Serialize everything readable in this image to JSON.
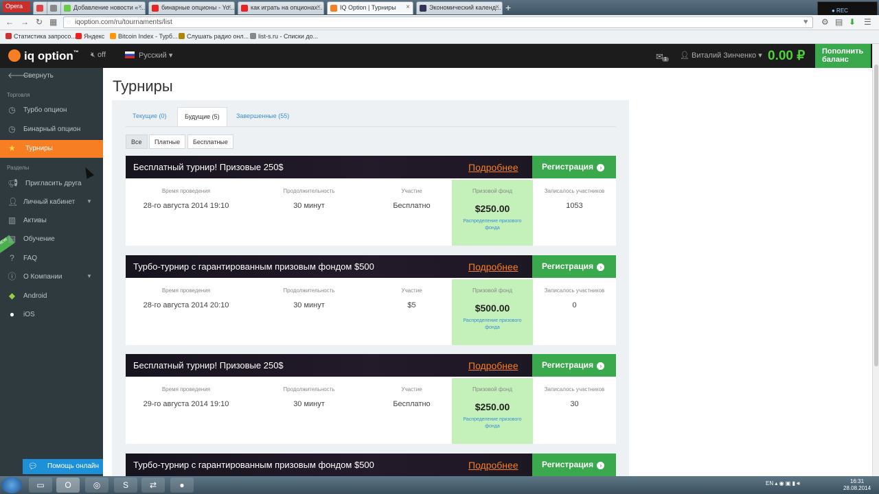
{
  "browser": {
    "opera_label": "Opera",
    "tabs": [
      {
        "label": "Добавление новости « ..."
      },
      {
        "label": "бинарные опционы - Yo..."
      },
      {
        "label": "как играть на опционах..."
      },
      {
        "label": "IQ Option | Турниры"
      },
      {
        "label": "Экономический календ..."
      }
    ],
    "url": "iqoption.com/ru/tournaments/list",
    "bookmarks": [
      {
        "label": "Статистика запросо..."
      },
      {
        "label": "Яндекс"
      },
      {
        "label": "Bitcoin Index - Турб..."
      },
      {
        "label": "Слушать радио онл..."
      },
      {
        "label": "list-s.ru - Списки до..."
      }
    ],
    "colors": {
      "accent": "#f77e23",
      "green": "#3aa84c",
      "balance": "#4cd137"
    }
  },
  "header": {
    "logo": "iq option",
    "logo_tm": "™",
    "sound": "off",
    "language": "Русский",
    "mail_count": "1",
    "user_name": "Виталий Зинченко",
    "balance": "0.00 ₽",
    "topup_line1": "Пополнить",
    "topup_line2": "баланс"
  },
  "sidebar": {
    "collapse": "Свернуть",
    "section_trading": "Торговля",
    "section_sections": "Разделы",
    "items": [
      {
        "label": "Турбо опцион",
        "icon": "clock-icon"
      },
      {
        "label": "Бинарный опцион",
        "icon": "clock-icon"
      },
      {
        "label": "Турниры",
        "icon": "star-icon"
      },
      {
        "label": "Пригласить друга",
        "icon": "megaphone-icon"
      },
      {
        "label": "Личный кабинет",
        "icon": "user-icon"
      },
      {
        "label": "Активы",
        "icon": "chart-icon"
      },
      {
        "label": "Обучение",
        "icon": "book-icon"
      },
      {
        "label": "FAQ",
        "icon": "question-icon"
      },
      {
        "label": "О Компании",
        "icon": "info-icon"
      },
      {
        "label": "Android",
        "icon": "android-icon"
      },
      {
        "label": "iOS",
        "icon": "apple-icon"
      }
    ],
    "help": "Помощь онлайн"
  },
  "main": {
    "title": "Турниры",
    "tabs": [
      {
        "label": "Текущие (0)"
      },
      {
        "label": "Будущие (5)"
      },
      {
        "label": "Завершенные (55)"
      }
    ],
    "filters": [
      {
        "label": "Все"
      },
      {
        "label": "Платные"
      },
      {
        "label": "Бесплатные"
      }
    ],
    "columns": {
      "time": "Время проведения",
      "duration": "Продолжительность",
      "entry": "Участие",
      "prize": "Призовой фонд",
      "participants": "Записалось участников"
    },
    "more_label": "Подробнее",
    "register_label": "Регистрация",
    "prize_link": "Распределение призового фонда",
    "tournaments": [
      {
        "title": "Бесплатный турнир! Призовые 250$",
        "time": "28-го августа 2014 19:10",
        "duration": "30 минут",
        "entry": "Бесплатно",
        "prize": "$250.00",
        "participants": "1053"
      },
      {
        "title": "Турбо-турнир с гарантированным призовым фондом $500",
        "time": "28-го августа 2014 20:10",
        "duration": "30 минут",
        "entry": "$5",
        "prize": "$500.00",
        "participants": "0"
      },
      {
        "title": "Бесплатный турнир! Призовые 250$",
        "time": "29-го августа 2014 19:10",
        "duration": "30 минут",
        "entry": "Бесплатно",
        "prize": "$250.00",
        "participants": "30"
      },
      {
        "title": "Турбо-турнир с гарантированным призовым фондом $500"
      }
    ]
  },
  "taskbar": {
    "lang": "EN",
    "time": "16:31",
    "date": "28.08.2014"
  }
}
